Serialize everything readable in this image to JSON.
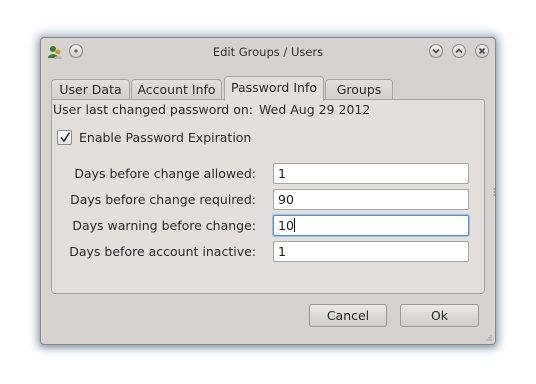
{
  "window": {
    "title": "Edit Groups / Users"
  },
  "titlebar": {
    "icons": [
      "app-icon",
      "menu-circle-icon",
      "minimize-icon",
      "maximize-icon",
      "close-icon"
    ]
  },
  "tabs": [
    {
      "label": "User Data",
      "active": false
    },
    {
      "label": "Account Info",
      "active": false
    },
    {
      "label": "Password Info",
      "active": true
    },
    {
      "label": "Groups",
      "active": false
    }
  ],
  "password_info": {
    "last_changed_label": "User last changed password on:",
    "last_changed_date": "Wed Aug 29 2012",
    "expiration_checkbox": {
      "label": "Enable Password Expiration",
      "checked": true
    },
    "fields": [
      {
        "label": "Days before change allowed:",
        "value": "1"
      },
      {
        "label": "Days before change required:",
        "value": "90"
      },
      {
        "label": "Days warning before change:",
        "value": "10"
      },
      {
        "label": "Days before account inactive:",
        "value": "1"
      }
    ]
  },
  "buttons": {
    "cancel": "Cancel",
    "ok": "Ok"
  },
  "colors": {
    "window_bg": "#d6d2d0",
    "panel_bg": "#e2dfdd",
    "focus_border": "#5d8fc4",
    "glow": "#7896aa"
  }
}
